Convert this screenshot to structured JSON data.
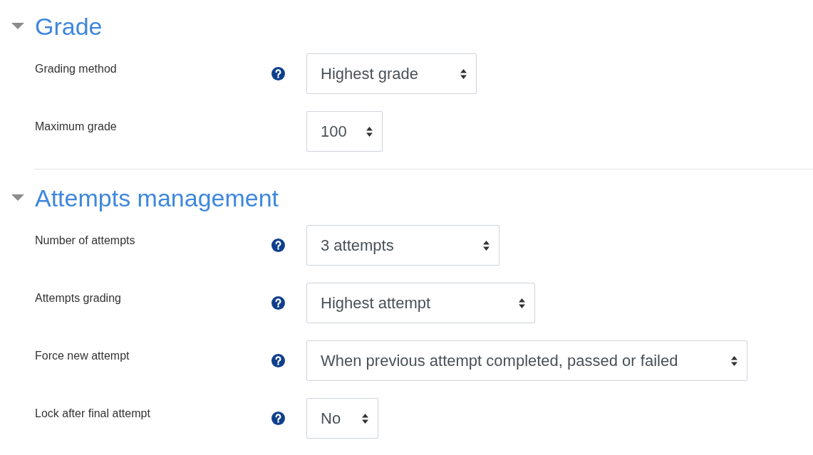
{
  "sections": [
    {
      "title": "Grade",
      "expanded": true,
      "fields": [
        {
          "label": "Grading method",
          "help": true,
          "value": "Highest grade"
        },
        {
          "label": "Maximum grade",
          "help": false,
          "value": "100"
        }
      ]
    },
    {
      "title": "Attempts management",
      "expanded": true,
      "fields": [
        {
          "label": "Number of attempts",
          "help": true,
          "value": "3 attempts"
        },
        {
          "label": "Attempts grading",
          "help": true,
          "value": "Highest attempt"
        },
        {
          "label": "Force new attempt",
          "help": true,
          "value": "When previous attempt completed, passed or failed"
        },
        {
          "label": "Lock after final attempt",
          "help": true,
          "value": "No"
        }
      ]
    }
  ]
}
